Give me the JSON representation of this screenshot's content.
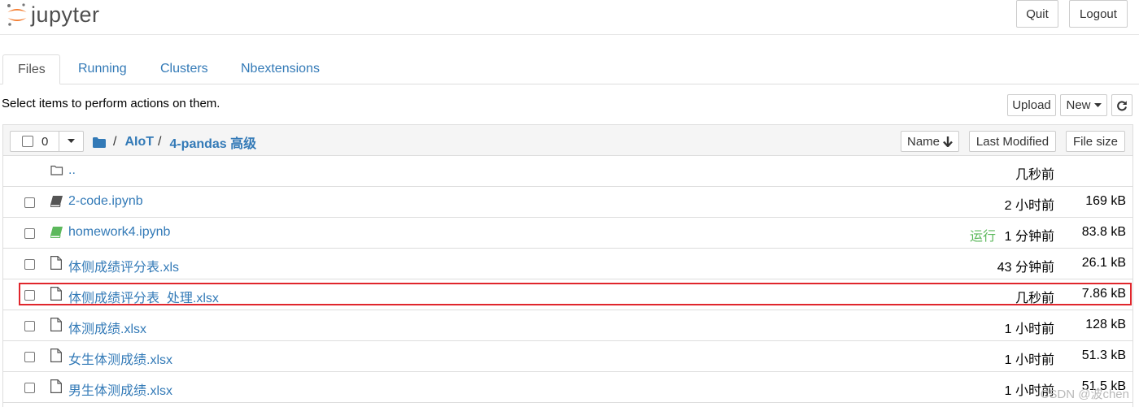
{
  "header": {
    "logo_text": "jupyter",
    "quit_label": "Quit",
    "logout_label": "Logout"
  },
  "tabs": [
    {
      "label": "Files",
      "active": true
    },
    {
      "label": "Running",
      "active": false
    },
    {
      "label": "Clusters",
      "active": false
    },
    {
      "label": "Nbextensions",
      "active": false
    }
  ],
  "toolbar": {
    "instructions": "Select items to perform actions on them.",
    "upload_label": "Upload",
    "new_label": "New",
    "refresh_icon": "refresh-icon"
  },
  "listing": {
    "selected_count": "0",
    "breadcrumb": [
      {
        "label": "AIoT"
      },
      {
        "label": "4-pandas 高级"
      }
    ],
    "sort": {
      "name_label": "Name",
      "last_modified_label": "Last Modified",
      "file_size_label": "File size"
    },
    "rows": [
      {
        "type": "parent",
        "icon": "folder-open-icon",
        "name": "..",
        "status": "",
        "modified": "几秒前",
        "size": ""
      },
      {
        "type": "notebook",
        "icon": "notebook-icon",
        "name": "2-code.ipynb",
        "status": "",
        "modified": "2 小时前",
        "size": "169 kB"
      },
      {
        "type": "notebook-running",
        "icon": "notebook-icon",
        "name": "homework4.ipynb",
        "status": "运行",
        "modified": "1 分钟前",
        "size": "83.8 kB"
      },
      {
        "type": "file",
        "icon": "file-icon",
        "name": "体侧成绩评分表.xls",
        "status": "",
        "modified": "43 分钟前",
        "size": "26.1 kB"
      },
      {
        "type": "file",
        "icon": "file-icon",
        "name": "体侧成绩评分表_处理.xlsx",
        "status": "",
        "modified": "几秒前",
        "size": "7.86 kB",
        "highlighted": true
      },
      {
        "type": "file",
        "icon": "file-icon",
        "name": "体测成绩.xlsx",
        "status": "",
        "modified": "1 小时前",
        "size": "128 kB"
      },
      {
        "type": "file",
        "icon": "file-icon",
        "name": "女生体测成绩.xlsx",
        "status": "",
        "modified": "1 小时前",
        "size": "51.3 kB"
      },
      {
        "type": "file",
        "icon": "file-icon",
        "name": "男生体测成绩.xlsx",
        "status": "",
        "modified": "1 小时前",
        "size": "51.5 kB"
      }
    ]
  },
  "colors": {
    "link": "#337ab7",
    "running": "#5cb85c",
    "highlight_border": "#e0262c",
    "logo_orange": "#f37726"
  },
  "watermark": "CSDN @波chen"
}
